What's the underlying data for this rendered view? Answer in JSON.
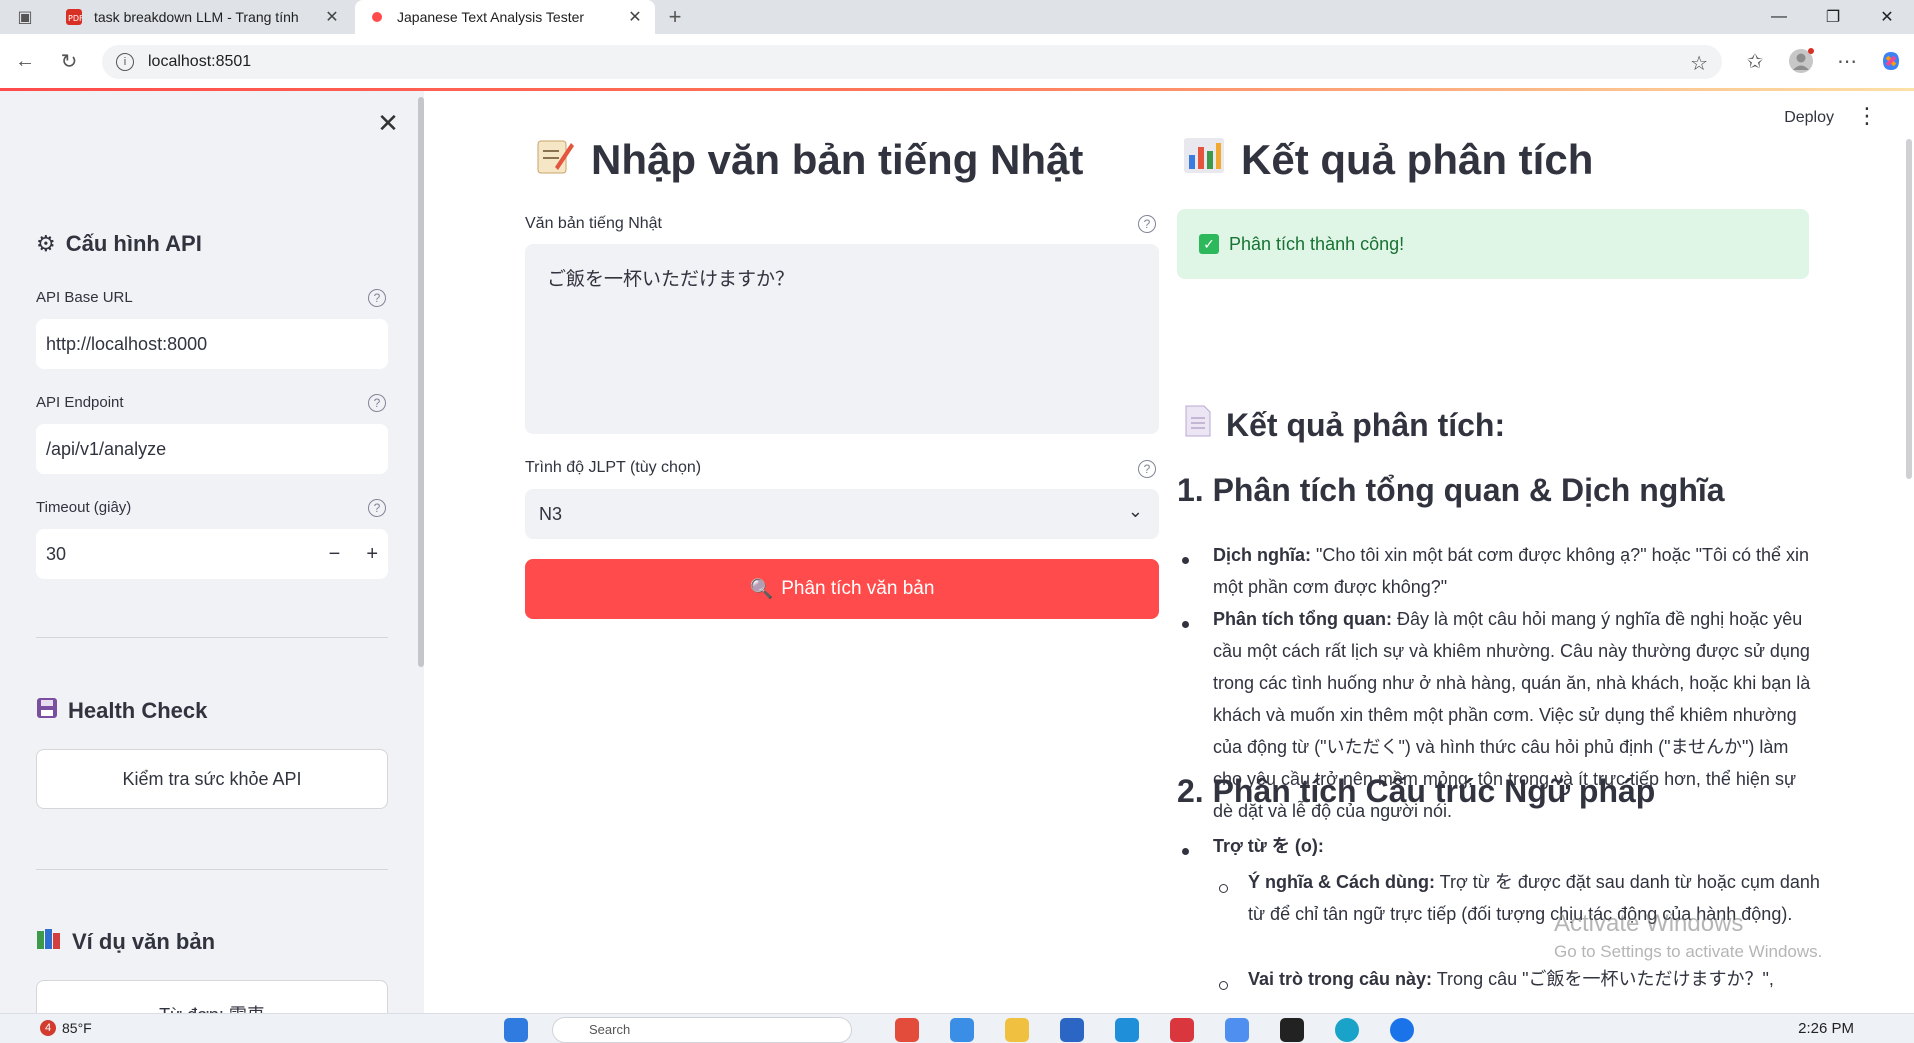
{
  "browser": {
    "tabs": [
      {
        "title": "task breakdown LLM - Trang tính"
      },
      {
        "title": "Japanese Text Analysis Tester"
      }
    ],
    "url": "localhost:8501"
  },
  "sidebar": {
    "api_section_title": "Cấu hình API",
    "base_url_label": "API Base URL",
    "base_url_value": "http://localhost:8000",
    "endpoint_label": "API Endpoint",
    "endpoint_value": "/api/v1/analyze",
    "timeout_label": "Timeout (giây)",
    "timeout_value": "30",
    "health_title": "Health Check",
    "health_button": "Kiểm tra sức khỏe API",
    "examples_title": "Ví dụ văn bản",
    "example_button": "Từ đơn: 雷車"
  },
  "header": {
    "deploy_label": "Deploy"
  },
  "input_panel": {
    "title": "Nhập văn bản tiếng Nhật",
    "text_label": "Văn bản tiếng Nhật",
    "text_value": "ご飯を一杯いただけますか？",
    "level_label": "Trình độ JLPT (tùy chọn)",
    "level_value": "N3",
    "analyze_button": "Phân tích văn bản"
  },
  "results": {
    "title": "Kết quả phân tích",
    "success_msg": "Phân tích thành công!",
    "subtitle": "Kết quả phân tích:",
    "section1_title": "1. Phân tích tổng quan & Dịch nghĩa",
    "translation_label": "Dịch nghĩa:",
    "translation_text": " \"Cho tôi xin một bát cơm được không ạ?\" hoặc \"Tôi có thể xin một phần cơm được không?\"",
    "overview_label": "Phân tích tổng quan:",
    "overview_text": " Đây là một câu hỏi mang ý nghĩa đề nghị hoặc yêu cầu một cách rất lịch sự và khiêm nhường. Câu này thường được sử dụng trong các tình huống như ở nhà hàng, quán ăn, nhà khách, hoặc khi bạn là khách và muốn xin thêm một phần cơm. Việc sử dụng thể khiêm nhường của động từ (\"いただく\") và hình thức câu hỏi phủ định (\"ませんか\") làm cho yêu cầu trở nên mềm mỏng, tôn trọng và ít trực tiếp hơn, thể hiện sự dè dặt và lễ độ của người nói.",
    "section2_title": "2. Phân tích Cấu trúc Ngữ pháp",
    "particle_label": "Trợ từ を (o):",
    "meaning_label": "Ý nghĩa & Cách dùng:",
    "meaning_text": " Trợ từ を được đặt sau danh từ hoặc cụm danh từ để chỉ tân ngữ trực tiếp (đối tượng chịu tác động của hành động).",
    "role_label": "Vai trò trong câu này:",
    "role_text": " Trong câu \"ご飯を一杯いただけますか？\","
  },
  "watermark": {
    "line1": "Activate Windows",
    "line2": "Go to Settings to activate Windows."
  },
  "taskbar": {
    "weather_badge": "4",
    "temperature": "85°F",
    "search_placeholder": "Search",
    "time": "2:26 PM"
  },
  "colors": {
    "primary": "#ff4b4b",
    "success_bg": "#dff5e6",
    "success_text": "#177233",
    "sidebar_bg": "#f0f2f6"
  }
}
